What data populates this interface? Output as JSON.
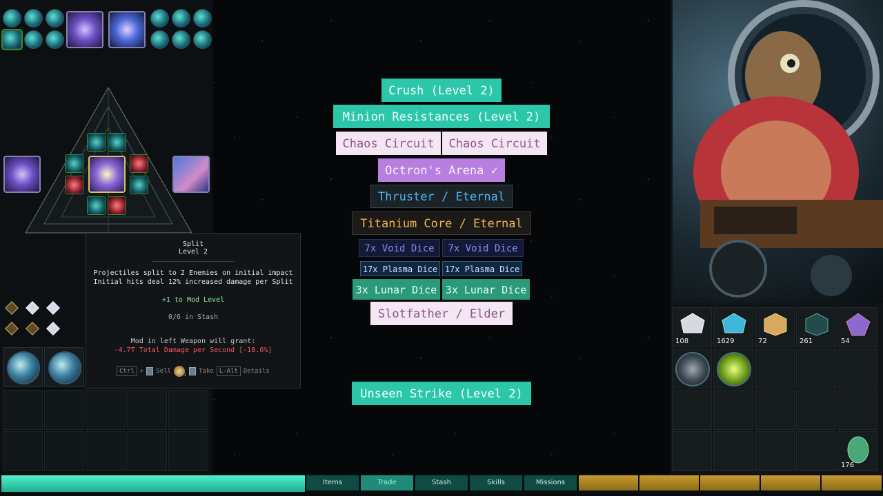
{
  "choices": {
    "crush": "Crush (Level 2)",
    "minion": "Minion Resistances (Level 2)",
    "chaos_a": "Chaos Circuit",
    "chaos_b": "Chaos Circuit",
    "octron": "Octron's Arena ✓",
    "thruster": "Thruster / Eternal",
    "titanium": "Titanium Core / Eternal",
    "void_a": "7x Void Dice",
    "void_b": "7x Void Dice",
    "plasma_a": "17x Plasma Dice",
    "plasma_b": "17x Plasma Dice",
    "lunar_a": "3x Lunar Dice",
    "lunar_b": "3x Lunar Dice",
    "slotfather": "Slotfather / Elder",
    "unseen": "Unseen Strike (Level 2)"
  },
  "tooltip": {
    "name": "Split",
    "level": "Level 2",
    "desc_line1": "Projectiles split to 2 Enemies on initial impact",
    "desc_line2": "Initial hits deal 12% increased damage per Split",
    "mod_level": "+1 to Mod Level",
    "stash": "0/6 in Stash",
    "grant_label": "Mod in left Weapon will grant:",
    "grant_value": "-4.7T Total Damage per Second [-18.6%]",
    "key_ctrl": "Ctrl",
    "plus": "+",
    "sell": "Sell",
    "coin_count": "1",
    "take": "Take",
    "key_alt": "L-Alt",
    "details": "Details"
  },
  "resources": [
    {
      "name": "white-crystal",
      "count": "108",
      "color": "#d8d8e0"
    },
    {
      "name": "blue-crystal",
      "count": "1629",
      "color": "#3fb8d8"
    },
    {
      "name": "gold-dice",
      "count": "72",
      "color": "#d6a860"
    },
    {
      "name": "teal-cube",
      "count": "261",
      "color": "#4ab0a8"
    },
    {
      "name": "rainbow-gem",
      "count": "54",
      "color": "#8a6ad0"
    }
  ],
  "egg": {
    "count": "176"
  },
  "tabs": {
    "items": "Items",
    "trade": "Trade",
    "stash": "Stash",
    "skills": "Skills",
    "missions": "Missions"
  }
}
